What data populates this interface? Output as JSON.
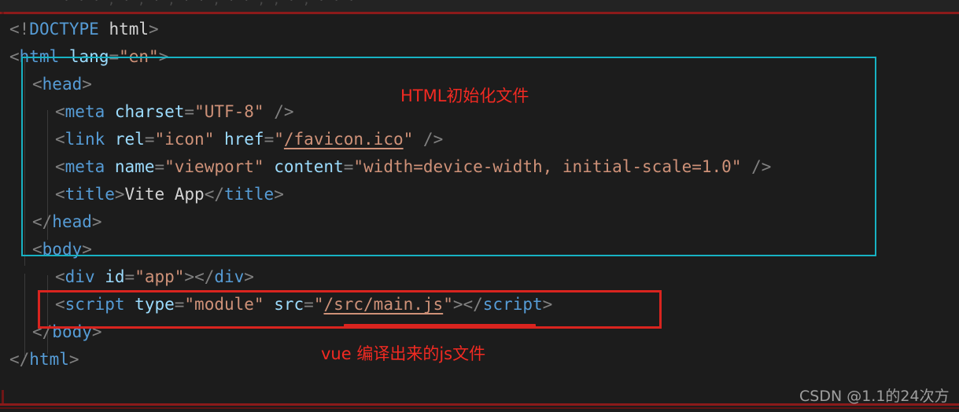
{
  "editor": {
    "theme_background": "#1c1c1c",
    "filename_hint": "index.html",
    "top_clipped_text": "· · · ,  ·  ,  ·  , · ·  ,   · ·  ,   ,   ·  ,   · ·  ·",
    "colors": {
      "tag": "#569cd6",
      "attribute": "#9cdcfe",
      "string": "#ce9178",
      "text": "#d4d4d4",
      "punctuation": "#808080",
      "annotation_red": "#f22a22",
      "box_red": "#d9241f",
      "box_teal": "#17b2c3",
      "watermark": "#b6b6b6"
    },
    "lines": [
      {
        "n": 1,
        "indent": 0,
        "segments": [
          {
            "c": "t",
            "v": "<!"
          },
          {
            "c": "doct",
            "v": "DOCTYPE"
          },
          {
            "c": "txt",
            "v": " html"
          },
          {
            "c": "t",
            "v": ">"
          }
        ]
      },
      {
        "n": 2,
        "indent": 0,
        "segments": [
          {
            "c": "t",
            "v": "<"
          },
          {
            "c": "tag",
            "v": "html"
          },
          {
            "c": "txt",
            "v": " "
          },
          {
            "c": "attr",
            "v": "lang"
          },
          {
            "c": "punc",
            "v": "="
          },
          {
            "c": "str",
            "v": "\"en\""
          },
          {
            "c": "t",
            "v": ">"
          }
        ]
      },
      {
        "n": 3,
        "indent": 1,
        "segments": [
          {
            "c": "t",
            "v": "<"
          },
          {
            "c": "tag",
            "v": "head"
          },
          {
            "c": "t",
            "v": ">"
          }
        ]
      },
      {
        "n": 4,
        "indent": 2,
        "segments": [
          {
            "c": "t",
            "v": "<"
          },
          {
            "c": "tag",
            "v": "meta"
          },
          {
            "c": "txt",
            "v": " "
          },
          {
            "c": "attr",
            "v": "charset"
          },
          {
            "c": "punc",
            "v": "="
          },
          {
            "c": "str",
            "v": "\"UTF-8\""
          },
          {
            "c": "txt",
            "v": " "
          },
          {
            "c": "t",
            "v": "/>"
          }
        ]
      },
      {
        "n": 5,
        "indent": 2,
        "segments": [
          {
            "c": "t",
            "v": "<"
          },
          {
            "c": "tag",
            "v": "link"
          },
          {
            "c": "txt",
            "v": " "
          },
          {
            "c": "attr",
            "v": "rel"
          },
          {
            "c": "punc",
            "v": "="
          },
          {
            "c": "str",
            "v": "\"icon\""
          },
          {
            "c": "txt",
            "v": " "
          },
          {
            "c": "attr",
            "v": "href"
          },
          {
            "c": "punc",
            "v": "="
          },
          {
            "c": "str",
            "v": "\""
          },
          {
            "c": "str ul",
            "v": "/favicon.ico"
          },
          {
            "c": "str",
            "v": "\""
          },
          {
            "c": "txt",
            "v": " "
          },
          {
            "c": "t",
            "v": "/>"
          }
        ]
      },
      {
        "n": 6,
        "indent": 2,
        "segments": [
          {
            "c": "t",
            "v": "<"
          },
          {
            "c": "tag",
            "v": "meta"
          },
          {
            "c": "txt",
            "v": " "
          },
          {
            "c": "attr",
            "v": "name"
          },
          {
            "c": "punc",
            "v": "="
          },
          {
            "c": "str",
            "v": "\"viewport\""
          },
          {
            "c": "txt",
            "v": " "
          },
          {
            "c": "attr",
            "v": "content"
          },
          {
            "c": "punc",
            "v": "="
          },
          {
            "c": "str",
            "v": "\"width=device-width, initial-scale=1.0\""
          },
          {
            "c": "txt",
            "v": " "
          },
          {
            "c": "t",
            "v": "/>"
          }
        ]
      },
      {
        "n": 7,
        "indent": 2,
        "segments": [
          {
            "c": "t",
            "v": "<"
          },
          {
            "c": "tag",
            "v": "title"
          },
          {
            "c": "t",
            "v": ">"
          },
          {
            "c": "txt",
            "v": "Vite App"
          },
          {
            "c": "t",
            "v": "</"
          },
          {
            "c": "tag",
            "v": "title"
          },
          {
            "c": "t",
            "v": ">"
          }
        ]
      },
      {
        "n": 8,
        "indent": 1,
        "segments": [
          {
            "c": "t",
            "v": "</"
          },
          {
            "c": "tag",
            "v": "head"
          },
          {
            "c": "t",
            "v": ">"
          }
        ]
      },
      {
        "n": 9,
        "indent": 1,
        "segments": [
          {
            "c": "t",
            "v": "<"
          },
          {
            "c": "tag",
            "v": "body"
          },
          {
            "c": "t",
            "v": ">"
          }
        ]
      },
      {
        "n": 10,
        "indent": 2,
        "segments": [
          {
            "c": "t",
            "v": "<"
          },
          {
            "c": "tag",
            "v": "div"
          },
          {
            "c": "txt",
            "v": " "
          },
          {
            "c": "attr",
            "v": "id"
          },
          {
            "c": "punc",
            "v": "="
          },
          {
            "c": "str",
            "v": "\"app\""
          },
          {
            "c": "t",
            "v": "></"
          },
          {
            "c": "tag",
            "v": "div"
          },
          {
            "c": "t",
            "v": ">"
          }
        ]
      },
      {
        "n": 11,
        "indent": 2,
        "segments": [
          {
            "c": "t",
            "v": "<"
          },
          {
            "c": "tag",
            "v": "script"
          },
          {
            "c": "txt",
            "v": " "
          },
          {
            "c": "attr",
            "v": "type"
          },
          {
            "c": "punc",
            "v": "="
          },
          {
            "c": "str",
            "v": "\"module\""
          },
          {
            "c": "txt",
            "v": " "
          },
          {
            "c": "attr",
            "v": "src"
          },
          {
            "c": "punc",
            "v": "="
          },
          {
            "c": "str",
            "v": "\""
          },
          {
            "c": "str ul",
            "v": "/src/main.js"
          },
          {
            "c": "str",
            "v": "\""
          },
          {
            "c": "t",
            "v": "></"
          },
          {
            "c": "tag",
            "v": "script"
          },
          {
            "c": "t",
            "v": ">"
          }
        ]
      },
      {
        "n": 12,
        "indent": 1,
        "segments": [
          {
            "c": "t",
            "v": "</"
          },
          {
            "c": "tag",
            "v": "body"
          },
          {
            "c": "t",
            "v": ">"
          }
        ]
      },
      {
        "n": 13,
        "indent": 0,
        "segments": [
          {
            "c": "t",
            "v": "</"
          },
          {
            "c": "tag",
            "v": "html"
          },
          {
            "c": "t",
            "v": ">"
          }
        ]
      }
    ]
  },
  "annotations": {
    "head_label": "HTML初始化文件",
    "script_label": "vue  编译出来的js文件"
  },
  "watermark": {
    "text": "CSDN @1.1的24次方"
  }
}
